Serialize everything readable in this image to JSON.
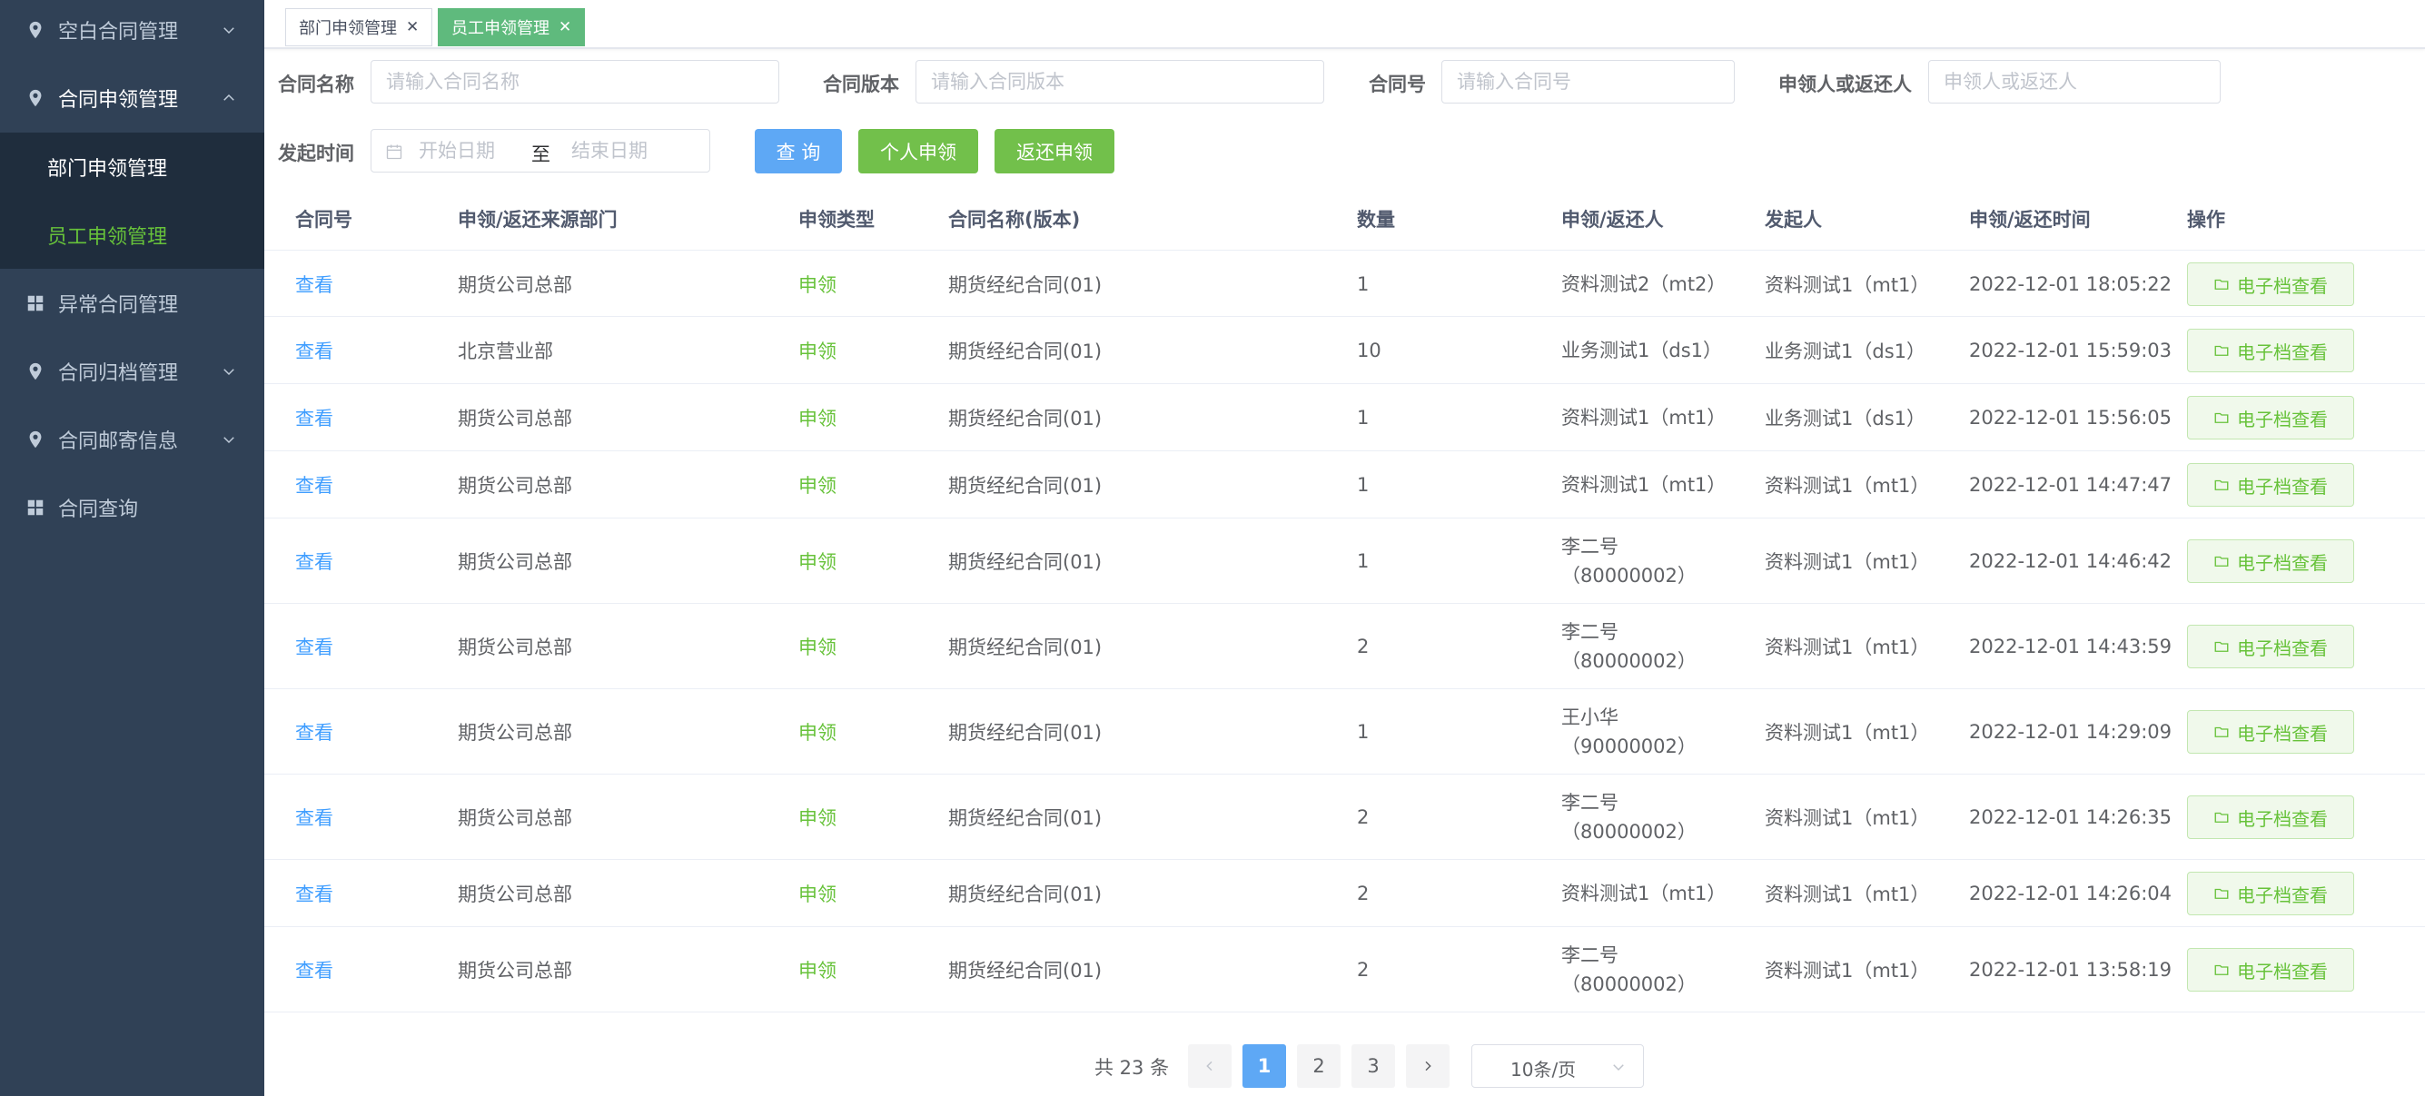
{
  "sidebar": {
    "menu": [
      {
        "label": "空白合同管理",
        "icon": "location-pin-icon"
      },
      {
        "label": "合同申领管理",
        "icon": "location-pin-icon"
      },
      {
        "label": "异常合同管理",
        "icon": "grid-icon"
      },
      {
        "label": "合同归档管理",
        "icon": "location-pin-icon"
      },
      {
        "label": "合同邮寄信息",
        "icon": "location-pin-icon"
      },
      {
        "label": "合同查询",
        "icon": "grid-icon"
      }
    ],
    "submenu": [
      {
        "label": "部门申领管理"
      },
      {
        "label": "员工申领管理",
        "active": true
      }
    ]
  },
  "tags": [
    {
      "label": "部门申领管理",
      "active": false
    },
    {
      "label": "员工申领管理",
      "active": true
    }
  ],
  "filters": {
    "contract_name": {
      "label": "合同名称",
      "placeholder": "请输入合同名称"
    },
    "contract_version": {
      "label": "合同版本",
      "placeholder": "请输入合同版本"
    },
    "contract_no": {
      "label": "合同号",
      "placeholder": "请输入合同号"
    },
    "applicant": {
      "label": "申领人或返还人",
      "placeholder": "申领人或返还人"
    },
    "start_time": {
      "label": "发起时间",
      "start_placeholder": "开始日期",
      "separator": "至",
      "end_placeholder": "结束日期"
    }
  },
  "buttons": {
    "query": "查 询",
    "personal_apply": "个人申领",
    "return_apply": "返还申领"
  },
  "table": {
    "columns": [
      "合同号",
      "申领/返还来源部门",
      "申领类型",
      "合同名称(版本)",
      "数量",
      "申领/返还人",
      "发起人",
      "申领/返还时间",
      "操作"
    ],
    "view_label": "查看",
    "action_label": "电子档查看",
    "rows": [
      {
        "dept": "期货公司总部",
        "type": "申领",
        "contract": "期货经纪合同(01)",
        "qty": "1",
        "person": "资料测试2（mt2）",
        "initiator": "资料测试1（mt1）",
        "time": "2022-12-01 18:05:22"
      },
      {
        "dept": "北京营业部",
        "type": "申领",
        "contract": "期货经纪合同(01)",
        "qty": "10",
        "person": "业务测试1（ds1）",
        "initiator": "业务测试1（ds1）",
        "time": "2022-12-01 15:59:03"
      },
      {
        "dept": "期货公司总部",
        "type": "申领",
        "contract": "期货经纪合同(01)",
        "qty": "1",
        "person": "资料测试1（mt1）",
        "initiator": "业务测试1（ds1）",
        "time": "2022-12-01 15:56:05"
      },
      {
        "dept": "期货公司总部",
        "type": "申领",
        "contract": "期货经纪合同(01)",
        "qty": "1",
        "person": "资料测试1（mt1）",
        "initiator": "资料测试1（mt1）",
        "time": "2022-12-01 14:47:47"
      },
      {
        "dept": "期货公司总部",
        "type": "申领",
        "contract": "期货经纪合同(01)",
        "qty": "1",
        "person": "李二号（80000002）",
        "initiator": "资料测试1（mt1）",
        "time": "2022-12-01 14:46:42"
      },
      {
        "dept": "期货公司总部",
        "type": "申领",
        "contract": "期货经纪合同(01)",
        "qty": "2",
        "person": "李二号（80000002）",
        "initiator": "资料测试1（mt1）",
        "time": "2022-12-01 14:43:59"
      },
      {
        "dept": "期货公司总部",
        "type": "申领",
        "contract": "期货经纪合同(01)",
        "qty": "1",
        "person": "王小华（90000002）",
        "initiator": "资料测试1（mt1）",
        "time": "2022-12-01 14:29:09"
      },
      {
        "dept": "期货公司总部",
        "type": "申领",
        "contract": "期货经纪合同(01)",
        "qty": "2",
        "person": "李二号（80000002）",
        "initiator": "资料测试1（mt1）",
        "time": "2022-12-01 14:26:35"
      },
      {
        "dept": "期货公司总部",
        "type": "申领",
        "contract": "期货经纪合同(01)",
        "qty": "2",
        "person": "资料测试1（mt1）",
        "initiator": "资料测试1（mt1）",
        "time": "2022-12-01 14:26:04"
      },
      {
        "dept": "期货公司总部",
        "type": "申领",
        "contract": "期货经纪合同(01)",
        "qty": "2",
        "person": "李二号（80000002）",
        "initiator": "资料测试1（mt1）",
        "time": "2022-12-01 13:58:19"
      }
    ]
  },
  "pagination": {
    "total_label": "共 23 条",
    "pages": [
      "1",
      "2",
      "3"
    ],
    "current_page": "1",
    "page_size_label": "10条/页"
  },
  "colors": {
    "sidebar_bg": "#304156",
    "submenu_bg": "#1f2d3d",
    "menu_text": "#bfcbd9",
    "active_green": "#67c23a",
    "primary_blue": "#409eff",
    "tag_active_bg": "#5fba7d"
  }
}
